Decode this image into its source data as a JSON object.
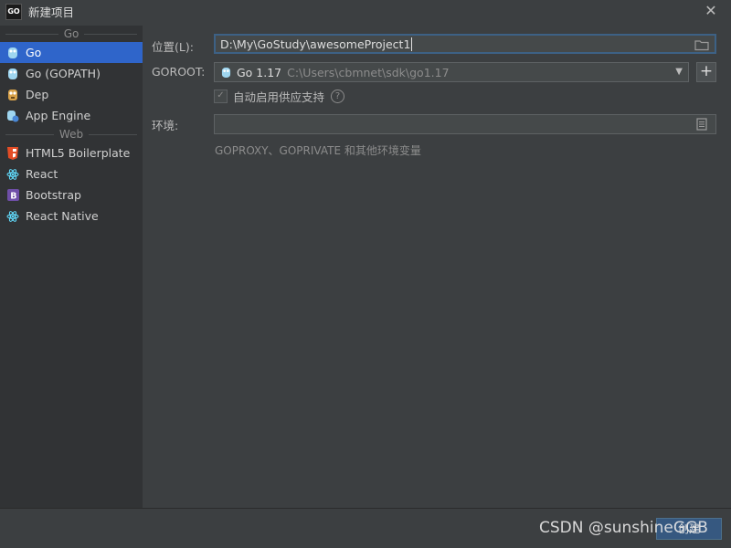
{
  "window": {
    "title": "新建项目",
    "app_icon_text": "GO"
  },
  "sidebar": {
    "groups": [
      {
        "header": "Go",
        "items": [
          {
            "label": "Go",
            "selected": true,
            "icon": "gopher-icon"
          },
          {
            "label": "Go (GOPATH)",
            "selected": false,
            "icon": "gopher-icon"
          },
          {
            "label": "Dep",
            "selected": false,
            "icon": "dep-icon"
          },
          {
            "label": "App Engine",
            "selected": false,
            "icon": "app-engine-icon"
          }
        ]
      },
      {
        "header": "Web",
        "items": [
          {
            "label": "HTML5 Boilerplate",
            "selected": false,
            "icon": "html5-icon"
          },
          {
            "label": "React",
            "selected": false,
            "icon": "react-icon"
          },
          {
            "label": "Bootstrap",
            "selected": false,
            "icon": "bootstrap-icon"
          },
          {
            "label": "React Native",
            "selected": false,
            "icon": "react-icon"
          }
        ]
      }
    ]
  },
  "form": {
    "location": {
      "label": "位置(L):",
      "value": "D:\\My\\GoStudy\\awesomeProject1"
    },
    "goroot": {
      "label": "GOROOT:",
      "version": "Go 1.17",
      "path": "C:\\Users\\cbmnet\\sdk\\go1.17"
    },
    "vendoring": {
      "label": "自动启用供应支持",
      "checked": true
    },
    "environment": {
      "label": "环境:",
      "value": "",
      "hint": "GOPROXY、GOPRIVATE 和其他环境变量"
    }
  },
  "footer": {
    "create_label": "创建"
  },
  "watermark": "CSDN @sunshineGGB"
}
